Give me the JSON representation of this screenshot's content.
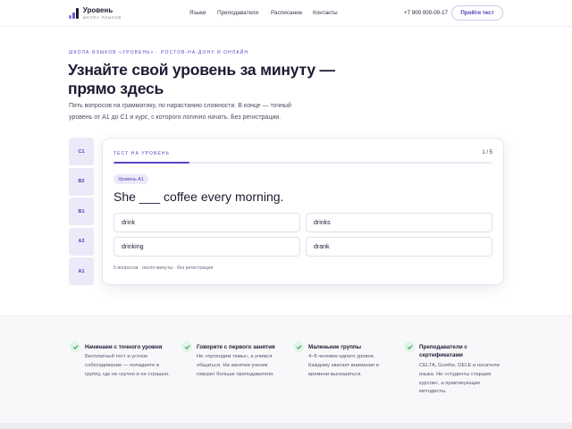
{
  "brand": {
    "name": "Уровень",
    "tagline": "ШКОЛА ЯЗЫКОВ",
    "colors": [
      "#1d1b33",
      "#5548c8",
      "#8a7de6"
    ]
  },
  "nav": {
    "items": [
      "Языки",
      "Преподаватели",
      "Расписание",
      "Контакты"
    ]
  },
  "header": {
    "phone": "+7 900 000-00-17",
    "cta_label": "Пройти тест"
  },
  "hero": {
    "eyebrow": "ШКОЛА ЯЗЫКОВ «УРОВЕНЬ» · РОСТОВ-НА-ДОНУ И ОНЛАЙН",
    "headline": "Узнайте свой уровень за минуту — прямо здесь",
    "lead": "Пять вопросов на грамматику, по нарастанию сложности. В конце — точный уровень от A1 до C1 и курс, с которого логично начать. Без регистрации."
  },
  "levels": [
    "C1",
    "B2",
    "B1",
    "A2",
    "A1"
  ],
  "quiz": {
    "title": "ТЕСТ НА УРОВЕНЬ",
    "counter": "1 / 5",
    "progress": 0.2,
    "level_chip": "Уровень A1",
    "question": "She ___ coffee every morning.",
    "options": [
      "drink",
      "drinks",
      "drinking",
      "drank"
    ],
    "footer": "5 вопросов · около минуты · без регистрации"
  },
  "features": [
    {
      "title": "Начинаем с точного уровня",
      "text": "Бесплатный тест и устное собеседование — попадаете в группу, где не скучно и не страшно."
    },
    {
      "title": "Говорите с первого занятия",
      "text": "Не «проходим темы», а учимся общаться. На занятии ученик говорит больше преподавателя."
    },
    {
      "title": "Маленькие группы",
      "text": "4–6 человек одного уровня. Каждому хватает внимания и времени высказаться."
    },
    {
      "title": "Преподаватели с сертификатами",
      "text": "CELTA, Goethe, DELE и носители языка. Не «студенты старших курсов», а практикующие методисты."
    }
  ],
  "icons": {
    "check": "check-icon",
    "logo": "bars-logo-icon"
  }
}
